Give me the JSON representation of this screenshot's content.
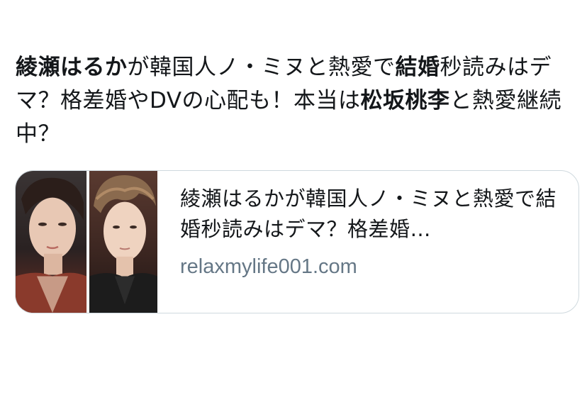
{
  "tweet": {
    "segments": [
      {
        "text": "綾瀬はるか",
        "bold": true
      },
      {
        "text": "が韓国人ノ・ミヌと熱愛で",
        "bold": false
      },
      {
        "text": "結婚",
        "bold": true
      },
      {
        "text": "秒読みはデマ？格差婚やDVの心配も！本当は",
        "bold": false
      },
      {
        "text": "松坂桃李",
        "bold": true
      },
      {
        "text": "と熱愛継続中？",
        "bold": false
      }
    ]
  },
  "card": {
    "title": "綾瀬はるかが韓国人ノ・ミヌと熱愛で結婚秒読みはデマ？格差婚…",
    "domain": "relaxmylife001.com",
    "thumbnail_icon": "two-portrait-photos"
  },
  "colors": {
    "text": "#14171a",
    "secondary": "#657786",
    "border": "#cfd9de"
  }
}
